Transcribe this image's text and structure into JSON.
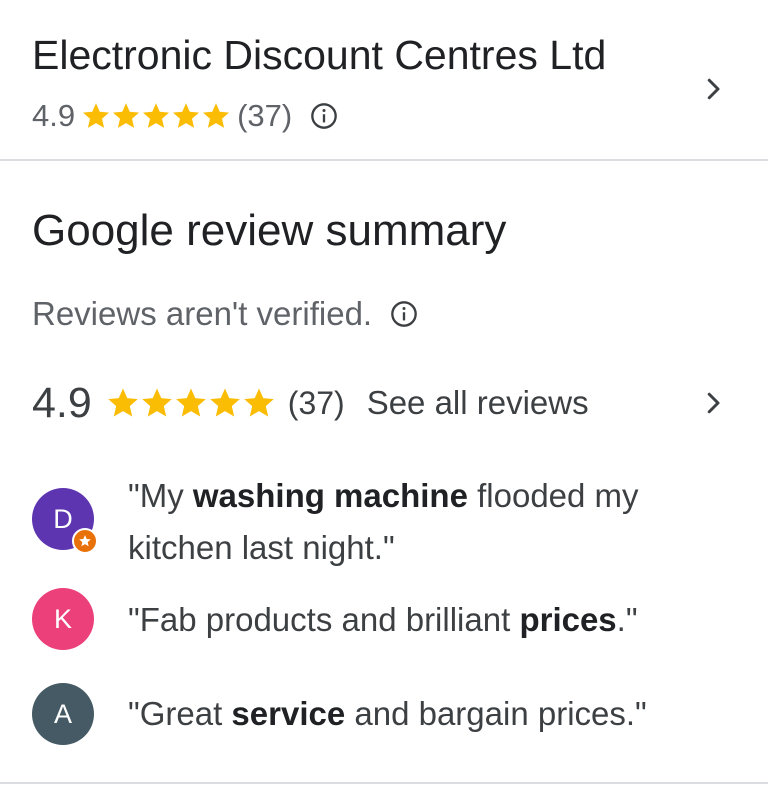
{
  "place": {
    "name": "Electronic Discount Centres Ltd",
    "rating": "4.9",
    "review_count": "(37)",
    "stars": 5
  },
  "summary": {
    "title": "Google review summary",
    "disclaimer": "Reviews aren't verified.",
    "rating": "4.9",
    "review_count": "(37)",
    "see_all_label": "See all reviews",
    "stars": 5
  },
  "reviews": [
    {
      "initial": "D",
      "avatar_color": "#5e35b1",
      "badge": "local-guide-star-icon",
      "quote_parts": [
        {
          "text": "\"My ",
          "bold": false
        },
        {
          "text": "washing machine",
          "bold": true
        },
        {
          "text": " flooded my kitchen last night.\"",
          "bold": false
        }
      ]
    },
    {
      "initial": "K",
      "avatar_color": "#ec407a",
      "quote_parts": [
        {
          "text": "\"Fab products and brilliant ",
          "bold": false
        },
        {
          "text": "prices",
          "bold": true
        },
        {
          "text": ".\"",
          "bold": false
        }
      ]
    },
    {
      "initial": "A",
      "avatar_color": "#455a64",
      "quote_parts": [
        {
          "text": "\"Great ",
          "bold": false
        },
        {
          "text": "service",
          "bold": true
        },
        {
          "text": " and bargain prices.\"",
          "bold": false
        }
      ]
    }
  ],
  "colors": {
    "star": "#fbbc04",
    "text_primary": "#202124",
    "text_secondary": "#5f6368",
    "divider": "#dadce0"
  }
}
